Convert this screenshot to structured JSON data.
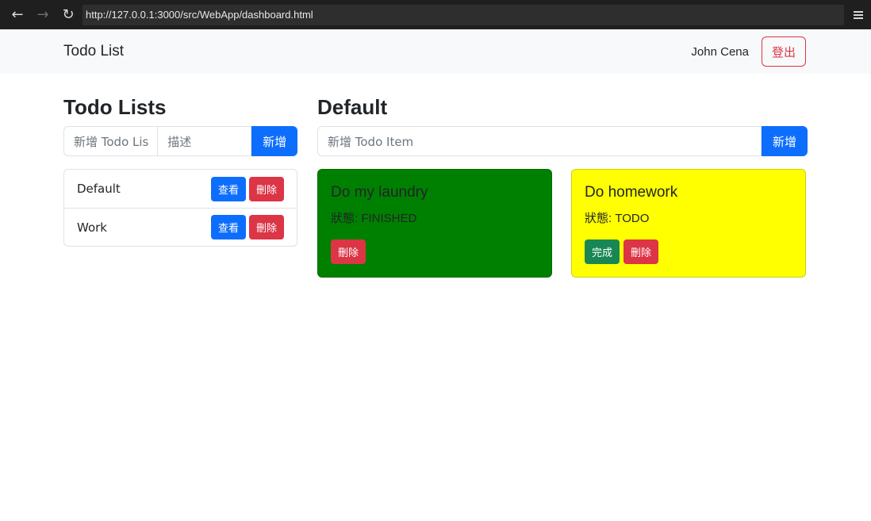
{
  "browser": {
    "url": "http://127.0.0.1:3000/src/WebApp/dashboard.html"
  },
  "navbar": {
    "brand": "Todo List",
    "user_name": "John Cena",
    "logout_label": "登出"
  },
  "lists_panel": {
    "heading": "Todo Lists",
    "name_placeholder": "新增 Todo Lis",
    "desc_placeholder": "描述",
    "add_label": "新增",
    "items": [
      {
        "name": "Default",
        "view_label": "查看",
        "delete_label": "刪除"
      },
      {
        "name": "Work",
        "view_label": "查看",
        "delete_label": "刪除"
      }
    ]
  },
  "items_panel": {
    "heading": "Default",
    "item_placeholder": "新增 Todo Item",
    "add_label": "新增",
    "cards": [
      {
        "title": "Do my laundry",
        "status": "狀態: FINISHED",
        "delete_label": "刪除",
        "color": "#008000"
      },
      {
        "title": "Do homework",
        "status": "狀態: TODO",
        "complete_label": "完成",
        "delete_label": "刪除",
        "color": "#ffff00"
      }
    ]
  }
}
